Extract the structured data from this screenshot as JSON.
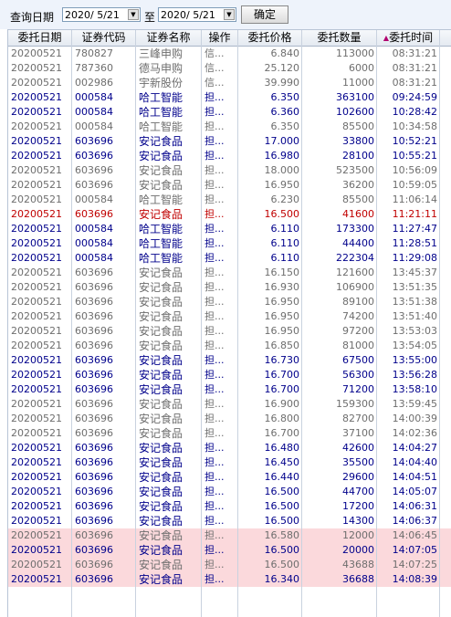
{
  "toolbar": {
    "query_date_label": "查询日期",
    "date_from": "2020/ 5/21",
    "to_label": "至",
    "date_to": "2020/ 5/21",
    "confirm_label": "确定",
    "dropdown_icon": "chevron-down-icon"
  },
  "table": {
    "columns": [
      "委托日期",
      "证券代码",
      "证券名称",
      "操作",
      "委托价格",
      "委托数量",
      "委托时间"
    ],
    "sort_icon": "▲",
    "colors": {
      "blue": "#00008b",
      "gray": "#6e6e6e",
      "red": "#c00000",
      "pink_row": "#fbd9dc"
    },
    "rows": [
      {
        "date": "20200521",
        "code": "780827",
        "name": "三峰申购",
        "op": "信...",
        "price": "6.840",
        "qty": "113000",
        "time": "08:31:21",
        "color": "gray",
        "bg": ""
      },
      {
        "date": "20200521",
        "code": "787360",
        "name": "德马申购",
        "op": "信...",
        "price": "25.120",
        "qty": "6000",
        "time": "08:31:21",
        "color": "gray",
        "bg": ""
      },
      {
        "date": "20200521",
        "code": "002986",
        "name": "宇新股份",
        "op": "信...",
        "price": "39.990",
        "qty": "11000",
        "time": "08:31:21",
        "color": "gray",
        "bg": ""
      },
      {
        "date": "20200521",
        "code": "000584",
        "name": "哈工智能",
        "op": "担...",
        "price": "6.350",
        "qty": "363100",
        "time": "09:24:59",
        "color": "blue",
        "bg": ""
      },
      {
        "date": "20200521",
        "code": "000584",
        "name": "哈工智能",
        "op": "担...",
        "price": "6.360",
        "qty": "102600",
        "time": "10:28:42",
        "color": "blue",
        "bg": ""
      },
      {
        "date": "20200521",
        "code": "000584",
        "name": "哈工智能",
        "op": "担...",
        "price": "6.350",
        "qty": "85500",
        "time": "10:34:58",
        "color": "gray",
        "bg": ""
      },
      {
        "date": "20200521",
        "code": "603696",
        "name": "安记食品",
        "op": "担...",
        "price": "17.000",
        "qty": "33800",
        "time": "10:52:21",
        "color": "blue",
        "bg": ""
      },
      {
        "date": "20200521",
        "code": "603696",
        "name": "安记食品",
        "op": "担...",
        "price": "16.980",
        "qty": "28100",
        "time": "10:55:21",
        "color": "blue",
        "bg": ""
      },
      {
        "date": "20200521",
        "code": "603696",
        "name": "安记食品",
        "op": "担...",
        "price": "18.000",
        "qty": "523500",
        "time": "10:56:09",
        "color": "gray",
        "bg": ""
      },
      {
        "date": "20200521",
        "code": "603696",
        "name": "安记食品",
        "op": "担...",
        "price": "16.950",
        "qty": "36200",
        "time": "10:59:05",
        "color": "gray",
        "bg": ""
      },
      {
        "date": "20200521",
        "code": "000584",
        "name": "哈工智能",
        "op": "担...",
        "price": "6.230",
        "qty": "85500",
        "time": "11:06:14",
        "color": "gray",
        "bg": ""
      },
      {
        "date": "20200521",
        "code": "603696",
        "name": "安记食品",
        "op": "担...",
        "price": "16.500",
        "qty": "41600",
        "time": "11:21:11",
        "color": "red",
        "bg": ""
      },
      {
        "date": "20200521",
        "code": "000584",
        "name": "哈工智能",
        "op": "担...",
        "price": "6.110",
        "qty": "173300",
        "time": "11:27:47",
        "color": "blue",
        "bg": ""
      },
      {
        "date": "20200521",
        "code": "000584",
        "name": "哈工智能",
        "op": "担...",
        "price": "6.110",
        "qty": "44400",
        "time": "11:28:51",
        "color": "blue",
        "bg": ""
      },
      {
        "date": "20200521",
        "code": "000584",
        "name": "哈工智能",
        "op": "担...",
        "price": "6.110",
        "qty": "222304",
        "time": "11:29:08",
        "color": "blue",
        "bg": ""
      },
      {
        "date": "20200521",
        "code": "603696",
        "name": "安记食品",
        "op": "担...",
        "price": "16.150",
        "qty": "121600",
        "time": "13:45:37",
        "color": "gray",
        "bg": ""
      },
      {
        "date": "20200521",
        "code": "603696",
        "name": "安记食品",
        "op": "担...",
        "price": "16.930",
        "qty": "106900",
        "time": "13:51:35",
        "color": "gray",
        "bg": ""
      },
      {
        "date": "20200521",
        "code": "603696",
        "name": "安记食品",
        "op": "担...",
        "price": "16.950",
        "qty": "89100",
        "time": "13:51:38",
        "color": "gray",
        "bg": ""
      },
      {
        "date": "20200521",
        "code": "603696",
        "name": "安记食品",
        "op": "担...",
        "price": "16.950",
        "qty": "74200",
        "time": "13:51:40",
        "color": "gray",
        "bg": ""
      },
      {
        "date": "20200521",
        "code": "603696",
        "name": "安记食品",
        "op": "担...",
        "price": "16.950",
        "qty": "97200",
        "time": "13:53:03",
        "color": "gray",
        "bg": ""
      },
      {
        "date": "20200521",
        "code": "603696",
        "name": "安记食品",
        "op": "担...",
        "price": "16.850",
        "qty": "81000",
        "time": "13:54:05",
        "color": "gray",
        "bg": ""
      },
      {
        "date": "20200521",
        "code": "603696",
        "name": "安记食品",
        "op": "担...",
        "price": "16.730",
        "qty": "67500",
        "time": "13:55:00",
        "color": "blue",
        "bg": ""
      },
      {
        "date": "20200521",
        "code": "603696",
        "name": "安记食品",
        "op": "担...",
        "price": "16.700",
        "qty": "56300",
        "time": "13:56:28",
        "color": "blue",
        "bg": ""
      },
      {
        "date": "20200521",
        "code": "603696",
        "name": "安记食品",
        "op": "担...",
        "price": "16.700",
        "qty": "71200",
        "time": "13:58:10",
        "color": "blue",
        "bg": ""
      },
      {
        "date": "20200521",
        "code": "603696",
        "name": "安记食品",
        "op": "担...",
        "price": "16.900",
        "qty": "159300",
        "time": "13:59:45",
        "color": "gray",
        "bg": ""
      },
      {
        "date": "20200521",
        "code": "603696",
        "name": "安记食品",
        "op": "担...",
        "price": "16.800",
        "qty": "82700",
        "time": "14:00:39",
        "color": "gray",
        "bg": ""
      },
      {
        "date": "20200521",
        "code": "603696",
        "name": "安记食品",
        "op": "担...",
        "price": "16.700",
        "qty": "37100",
        "time": "14:02:36",
        "color": "gray",
        "bg": ""
      },
      {
        "date": "20200521",
        "code": "603696",
        "name": "安记食品",
        "op": "担...",
        "price": "16.480",
        "qty": "42600",
        "time": "14:04:27",
        "color": "blue",
        "bg": ""
      },
      {
        "date": "20200521",
        "code": "603696",
        "name": "安记食品",
        "op": "担...",
        "price": "16.450",
        "qty": "35500",
        "time": "14:04:40",
        "color": "blue",
        "bg": ""
      },
      {
        "date": "20200521",
        "code": "603696",
        "name": "安记食品",
        "op": "担...",
        "price": "16.440",
        "qty": "29600",
        "time": "14:04:51",
        "color": "blue",
        "bg": ""
      },
      {
        "date": "20200521",
        "code": "603696",
        "name": "安记食品",
        "op": "担...",
        "price": "16.500",
        "qty": "44700",
        "time": "14:05:07",
        "color": "blue",
        "bg": ""
      },
      {
        "date": "20200521",
        "code": "603696",
        "name": "安记食品",
        "op": "担...",
        "price": "16.500",
        "qty": "17200",
        "time": "14:06:31",
        "color": "blue",
        "bg": ""
      },
      {
        "date": "20200521",
        "code": "603696",
        "name": "安记食品",
        "op": "担...",
        "price": "16.500",
        "qty": "14300",
        "time": "14:06:37",
        "color": "blue",
        "bg": ""
      },
      {
        "date": "20200521",
        "code": "603696",
        "name": "安记食品",
        "op": "担...",
        "price": "16.580",
        "qty": "12000",
        "time": "14:06:45",
        "color": "gray",
        "bg": "pink"
      },
      {
        "date": "20200521",
        "code": "603696",
        "name": "安记食品",
        "op": "担...",
        "price": "16.500",
        "qty": "20000",
        "time": "14:07:05",
        "color": "blue",
        "bg": "pink"
      },
      {
        "date": "20200521",
        "code": "603696",
        "name": "安记食品",
        "op": "担...",
        "price": "16.500",
        "qty": "43688",
        "time": "14:07:25",
        "color": "gray",
        "bg": "pink"
      },
      {
        "date": "20200521",
        "code": "603696",
        "name": "安记食品",
        "op": "担...",
        "price": "16.340",
        "qty": "36688",
        "time": "14:08:39",
        "color": "blue",
        "bg": "pink"
      }
    ]
  }
}
